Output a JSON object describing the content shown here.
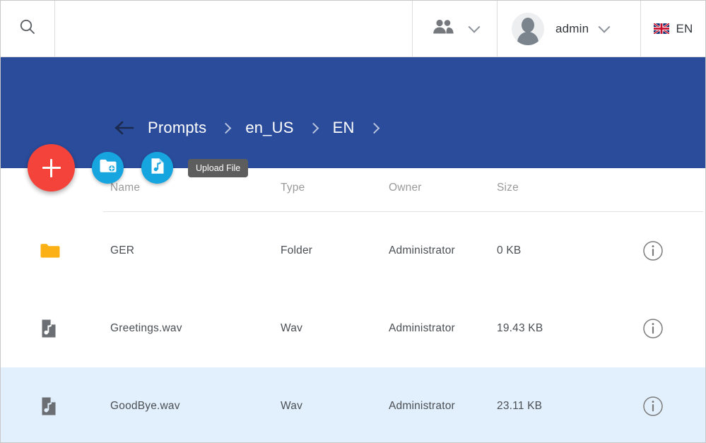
{
  "topbar": {
    "search_icon": "search-icon",
    "users_icon": "people-group-icon",
    "users_chevron": "chevron-down-icon",
    "username": "admin",
    "account_chevron": "chevron-down-icon",
    "avatar_icon": "user-avatar-icon",
    "language_label": "EN",
    "language_flag": "uk-flag-icon"
  },
  "breadcrumb": {
    "back_icon": "back-arrow-icon",
    "items": [
      {
        "label": "Prompts"
      },
      {
        "label": "en_US"
      },
      {
        "label": "EN"
      }
    ],
    "trailing_separator": ">"
  },
  "actions": {
    "main_label": "+",
    "new_folder_icon": "folder-add-icon",
    "upload_file_icon": "audio-file-add-icon",
    "tooltip": "Upload File"
  },
  "table": {
    "columns": [
      "Name",
      "Type",
      "Owner",
      "Size"
    ],
    "rows": [
      {
        "icon": "folder-icon",
        "name": "GER",
        "type": "Folder",
        "owner": "Administrator",
        "size": "0 KB",
        "info_icon": "info-icon",
        "selected": false
      },
      {
        "icon": "audio-file-icon",
        "name": "Greetings.wav",
        "type": "Wav",
        "owner": "Administrator",
        "size": "19.43 KB",
        "info_icon": "info-icon",
        "selected": false
      },
      {
        "icon": "audio-file-icon",
        "name": "GoodBye.wav",
        "type": "Wav",
        "owner": "Administrator",
        "size": "23.11 KB",
        "info_icon": "info-icon",
        "selected": true
      }
    ]
  },
  "colors": {
    "header_blue": "#2a4c9b",
    "fab_red": "#f4433a",
    "fab_blue": "#17a5e0",
    "folder_orange": "#fbb015",
    "row_selected": "#e2effc",
    "tooltip_gray": "#5d5d5d"
  }
}
